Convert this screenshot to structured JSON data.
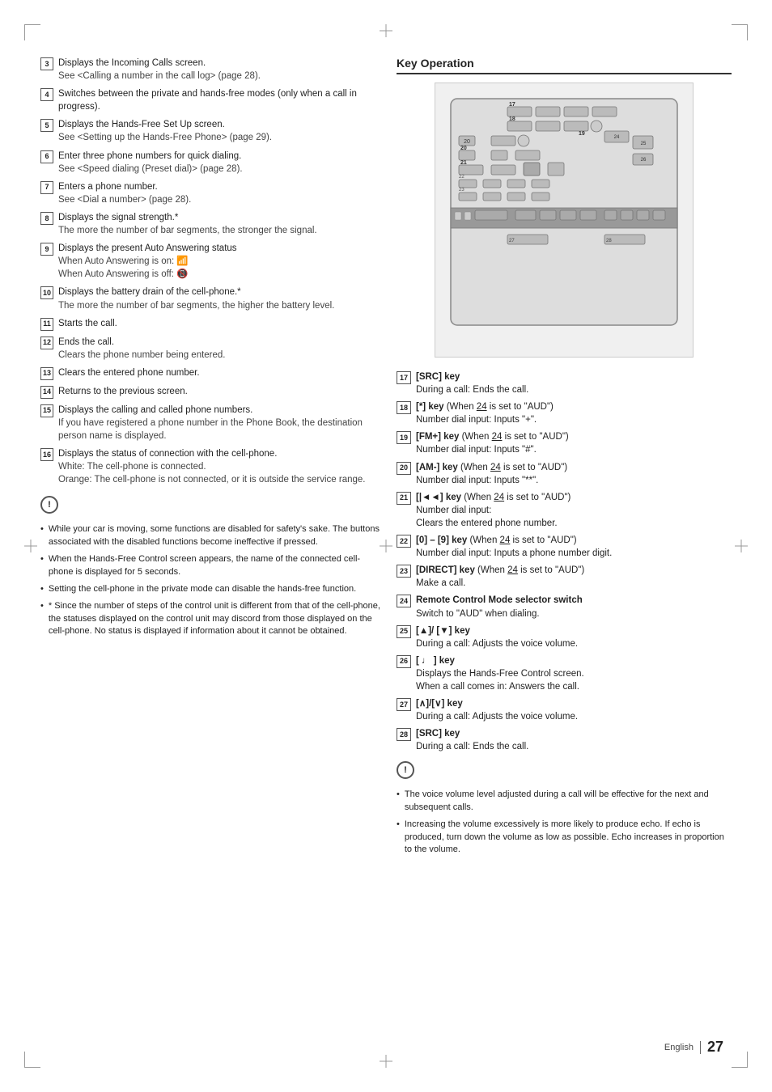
{
  "page": {
    "language": "English",
    "page_number": "27"
  },
  "left_column": {
    "items": [
      {
        "number": "3",
        "text": "Displays the Incoming Calls screen.",
        "sub": "See <Calling a number in the call log> (page 28)."
      },
      {
        "number": "4",
        "text": "Switches between the private and hands-free modes (only when a call in progress).",
        "sub": null
      },
      {
        "number": "5",
        "text": "Displays the Hands-Free Set Up screen.",
        "sub": "See <Setting up the Hands-Free Phone> (page 29)."
      },
      {
        "number": "6",
        "text": "Enter three phone numbers for quick dialing.",
        "sub": "See <Speed dialing (Preset dial)> (page 28)."
      },
      {
        "number": "7",
        "text": "Enters a phone number.",
        "sub": "See <Dial a number> (page 28)."
      },
      {
        "number": "8",
        "text": "Displays the signal strength.*",
        "sub": "The more the number of bar segments, the stronger the signal."
      },
      {
        "number": "9",
        "text": "Displays the present Auto Answering status",
        "sub": "When Auto Answering is on: [icon]\nWhen Auto Answering is off: [icon]"
      },
      {
        "number": "10",
        "text": "Displays the battery drain of the cell-phone.*",
        "sub": "The more the number of bar segments, the higher the battery level."
      },
      {
        "number": "11",
        "text": "Starts the call.",
        "sub": null
      },
      {
        "number": "12",
        "text": "Ends the call.",
        "sub": "Clears the phone number being entered."
      },
      {
        "number": "13",
        "text": "Clears the entered phone number.",
        "sub": null
      },
      {
        "number": "14",
        "text": "Returns to the previous screen.",
        "sub": null
      },
      {
        "number": "15",
        "text": "Displays the calling and called phone numbers.",
        "sub": "If you have registered a phone number in the Phone Book, the destination person name is displayed."
      },
      {
        "number": "16",
        "text": "Displays the status of connection with the cell-phone.",
        "sub_white": "White: The cell-phone is connected.",
        "sub_orange": "Orange: The cell-phone is not connected, or it is outside the service range."
      }
    ],
    "note_items": [
      "While your car is moving, some functions are disabled for safety's sake. The buttons associated with the disabled functions become ineffective if pressed.",
      "When the Hands-Free Control screen appears, the name of the connected cell-phone is displayed for 5 seconds.",
      "Setting the cell-phone in the private mode can disable the hands-free function.",
      "* Since the number of steps of the control unit is different from that of the cell-phone, the statuses displayed on the control unit may discord from those displayed on the cell-phone. No status is displayed if information about it cannot be obtained."
    ]
  },
  "right_column": {
    "title": "Key Operation",
    "items": [
      {
        "number": "17",
        "label": "[SRC] key",
        "bold": true,
        "details": [
          "During a call:  Ends the call."
        ]
      },
      {
        "number": "18",
        "label": "[*] key",
        "bold": true,
        "qualifier": "(When 24 is set to \"AUD\")",
        "details": [
          "Number dial input:  Inputs \"+\"."
        ]
      },
      {
        "number": "19",
        "label": "[FM+] key",
        "bold": true,
        "qualifier": "(When 24 is set to \"AUD\")",
        "details": [
          "Number dial input:  Inputs \"#\"."
        ]
      },
      {
        "number": "20",
        "label": "[AM-] key",
        "bold": true,
        "qualifier": "(When 24 is set to \"AUD\")",
        "details": [
          "Number dial input:  Inputs \"**\"."
        ]
      },
      {
        "number": "21",
        "label": "[|◄◄] key",
        "bold": true,
        "qualifier": "(When 24 is set to \"AUD\")",
        "details": [
          "Number dial input:",
          "Clears the entered phone number."
        ]
      },
      {
        "number": "22",
        "label": "[0] – [9] key",
        "bold": true,
        "qualifier": "(When 24 is set to \"AUD\")",
        "details": [
          "Number dial input:  Inputs a phone number digit."
        ]
      },
      {
        "number": "23",
        "label": "[DIRECT] key",
        "bold": true,
        "qualifier": "(When 24 is set to \"AUD\")",
        "details": [
          "Make a call."
        ]
      },
      {
        "number": "24",
        "label": "Remote Control Mode selector switch",
        "bold": true,
        "details": [
          "Switch to \"AUD\" when dialing."
        ]
      },
      {
        "number": "25",
        "label": "[▲]/ [▼] key",
        "bold": true,
        "details": [
          "During a call: Adjusts the voice volume."
        ]
      },
      {
        "number": "26",
        "label": "[ (/) ] key",
        "bold": true,
        "details": [
          "Displays the Hands-Free Control screen.",
          "When a call comes in: Answers the call."
        ]
      },
      {
        "number": "27",
        "label": "[∧]/[∨] key",
        "bold": true,
        "details": [
          "During a call: Adjusts the voice volume."
        ]
      },
      {
        "number": "28",
        "label": "[SRC] key",
        "bold": true,
        "details": [
          "During a call:  Ends the call."
        ]
      }
    ],
    "note_items": [
      "The voice volume level adjusted during a call will be effective for the next and subsequent calls.",
      "Increasing the volume excessively is more likely to produce echo. If echo is produced, turn down the volume as low as possible. Echo increases in proportion to the volume."
    ]
  }
}
